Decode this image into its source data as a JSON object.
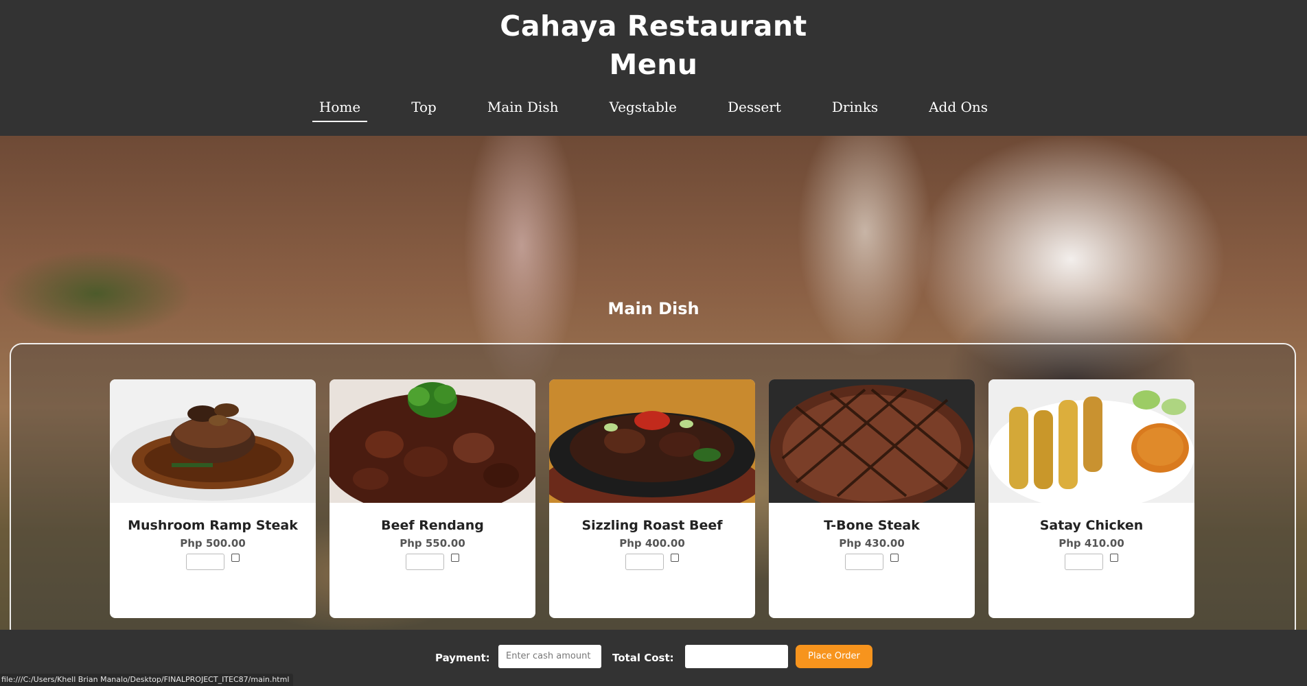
{
  "header": {
    "title_line1": "Cahaya Restaurant",
    "title_line2": "Menu"
  },
  "nav": {
    "items": [
      "Home",
      "Top",
      "Main Dish",
      "Vegstable",
      "Dessert",
      "Drinks",
      "Add Ons"
    ],
    "active": "Home"
  },
  "section": {
    "title": "Main Dish"
  },
  "dishes": [
    {
      "name": "Mushroom Ramp Steak",
      "price": "Php 500.00"
    },
    {
      "name": "Beef Rendang",
      "price": "Php 550.00"
    },
    {
      "name": "Sizzling Roast Beef",
      "price": "Php 400.00"
    },
    {
      "name": "T-Bone Steak",
      "price": "Php 430.00"
    },
    {
      "name": "Satay Chicken",
      "price": "Php 410.00"
    }
  ],
  "footer": {
    "payment_label": "Payment:",
    "payment_placeholder": "Enter cash amount",
    "total_label": "Total Cost:",
    "total_value": "",
    "place_order_label": "Place Order"
  },
  "status_bar": {
    "url": "file:///C:/Users/Khell Brian Manalo/Desktop/FINALPROJECT_ITEC87/main.html"
  },
  "colors": {
    "header_bg": "#333333",
    "accent": "#f7941d",
    "card_bg": "#ffffff"
  }
}
